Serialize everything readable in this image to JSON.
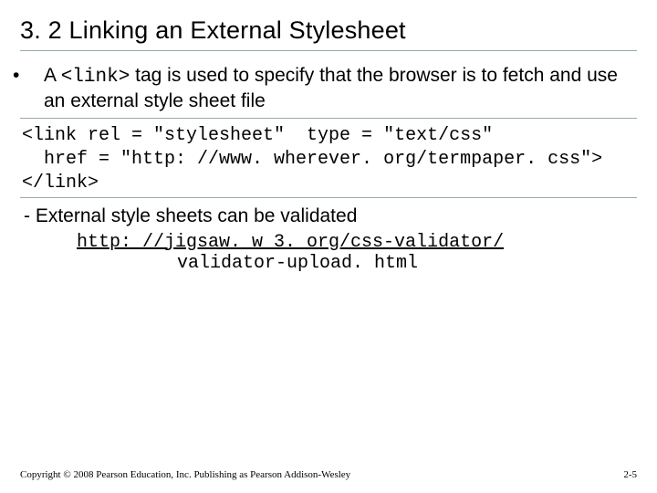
{
  "title": "3. 2 Linking an External Stylesheet",
  "bullet": {
    "prefix": "A ",
    "code": "<link>",
    "rest": " tag is used to specify that the browser is to fetch and use an external style sheet file"
  },
  "code": {
    "l1": "<link rel = \"stylesheet\"  type = \"text/css\"",
    "l2": "  href = \"http: //www. wherever. org/termpaper. css\">",
    "l3": "</link>"
  },
  "dash": "External style sheets can be validated",
  "linkline": "http: //jigsaw. w 3. org/css-validator/",
  "linkline2": "validator-upload. html",
  "footer": "Copyright © 2008 Pearson Education, Inc. Publishing as Pearson Addison-Wesley",
  "pagenum": "2-5"
}
